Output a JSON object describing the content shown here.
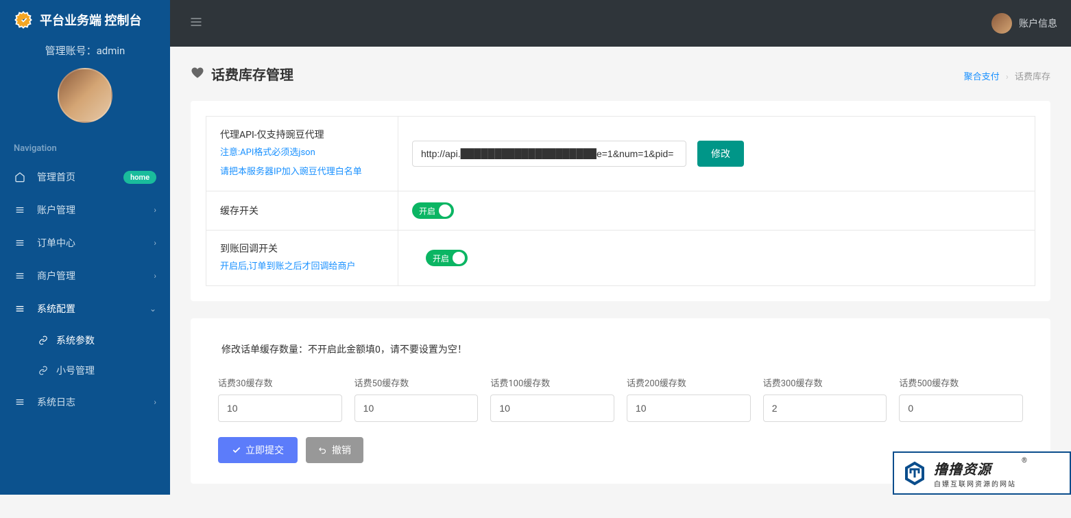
{
  "sidebar": {
    "logo_text": "平台业务端 控制台",
    "admin_account": "管理账号：admin",
    "nav_label": "Navigation",
    "items": [
      {
        "label": "管理首页",
        "badge": "home"
      },
      {
        "label": "账户管理"
      },
      {
        "label": "订单中心"
      },
      {
        "label": "商户管理"
      },
      {
        "label": "系统配置",
        "subs": [
          {
            "label": "系统参数",
            "active": true
          },
          {
            "label": "小号管理"
          }
        ]
      },
      {
        "label": "系统日志"
      }
    ]
  },
  "topbar": {
    "user_label": "账户信息"
  },
  "page": {
    "title": "话费库存管理",
    "breadcrumb": {
      "parent": "聚合支付",
      "current": "话费库存"
    }
  },
  "settings": {
    "api": {
      "title": "代理API-仅支持豌豆代理",
      "note1": "注意:API格式必须选json",
      "note2": "请把本服务器IP加入豌豆代理白名单",
      "value": "http://api.████████████████████e=1&num=1&pid=",
      "btn": "修改"
    },
    "cache_switch": {
      "label": "缓存开关",
      "state": "开启"
    },
    "callback_switch": {
      "label": "到账回调开关",
      "note": "开启后,订单到账之后才回调给商户",
      "state": "开启"
    }
  },
  "cache": {
    "instruction": "修改话单缓存数量：不开启此金额填0，请不要设置为空！",
    "fields": [
      {
        "label": "话费30缓存数",
        "value": "10"
      },
      {
        "label": "话费50缓存数",
        "value": "10"
      },
      {
        "label": "话费100缓存数",
        "value": "10"
      },
      {
        "label": "话费200缓存数",
        "value": "10"
      },
      {
        "label": "话费300缓存数",
        "value": "2"
      },
      {
        "label": "话费500缓存数",
        "value": "0"
      }
    ],
    "submit": "立即提交",
    "cancel": "撤销"
  },
  "watermark": {
    "title": "撸撸资源",
    "sub": "白嫖互联网资源的网站"
  }
}
